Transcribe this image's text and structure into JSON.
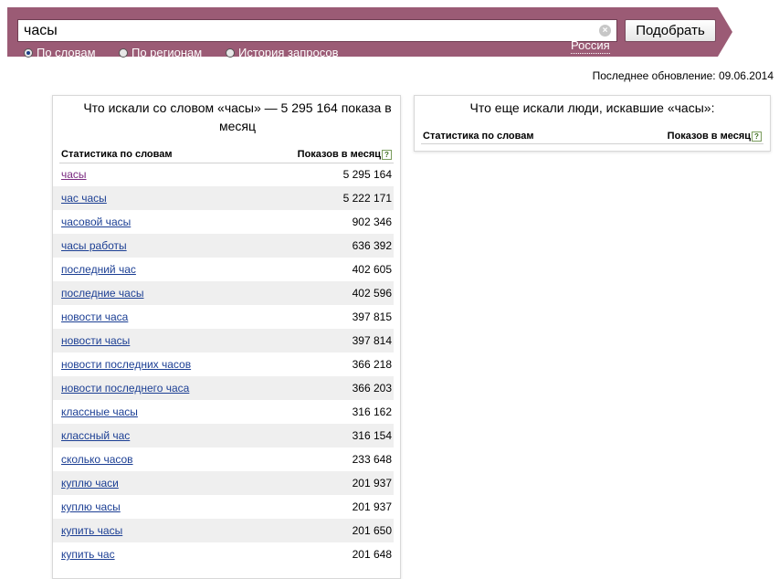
{
  "search": {
    "query": "часы",
    "submit_label": "Подобрать",
    "modes": [
      {
        "label": "По словам",
        "checked": true
      },
      {
        "label": "По регионам",
        "checked": false
      },
      {
        "label": "История запросов",
        "checked": false
      }
    ],
    "region": "Россия"
  },
  "last_update": "Последнее обновление: 09.06.2014",
  "left_panel": {
    "title": "Что искали со словом «часы» — 5 295 164 показа в месяц",
    "col_words": "Статистика по словам",
    "col_count": "Показов в месяц",
    "rows": [
      {
        "phrase": "часы",
        "count": "5 295 164"
      },
      {
        "phrase": "час часы",
        "count": "5 222 171"
      },
      {
        "phrase": "часовой часы",
        "count": "902 346"
      },
      {
        "phrase": "часы работы",
        "count": "636 392"
      },
      {
        "phrase": "последний час",
        "count": "402 605"
      },
      {
        "phrase": "последние часы",
        "count": "402 596"
      },
      {
        "phrase": "новости часа",
        "count": "397 815"
      },
      {
        "phrase": "новости часы",
        "count": "397 814"
      },
      {
        "phrase": "новости последних часов",
        "count": "366 218"
      },
      {
        "phrase": "новости последнего часа",
        "count": "366 203"
      },
      {
        "phrase": "классные часы",
        "count": "316 162"
      },
      {
        "phrase": "классный час",
        "count": "316 154"
      },
      {
        "phrase": "сколько часов",
        "count": "233 648"
      },
      {
        "phrase": "куплю часи",
        "count": "201 937"
      },
      {
        "phrase": "куплю часы",
        "count": "201 937"
      },
      {
        "phrase": "купить часы",
        "count": "201 650"
      },
      {
        "phrase": "купить час",
        "count": "201 648"
      }
    ]
  },
  "right_panel": {
    "title": "Что еще искали люди, искавшие «часы»:",
    "col_words": "Статистика по словам",
    "col_count": "Показов в месяц"
  },
  "colors": {
    "bar": "#9b5b75",
    "link": "#1c3f94",
    "visited_link": "#7a2a80",
    "row_shade": "#efefef"
  }
}
